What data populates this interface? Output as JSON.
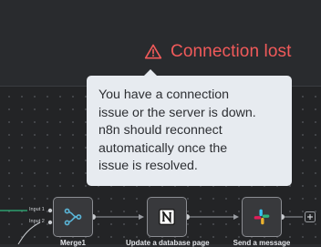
{
  "status": {
    "label": "Connection lost",
    "icon": "warning-triangle-icon",
    "color": "#f15a5a"
  },
  "tooltip": {
    "lines": [
      "You have a connection",
      "issue or the server is down.",
      "n8n should reconnect",
      "automatically once the",
      "issue is resolved."
    ]
  },
  "workflow": {
    "nodes": [
      {
        "label": "Merge1",
        "icon": "merge-icon",
        "inputs": [
          "Input 1",
          "Input 2"
        ]
      },
      {
        "label": "Update a database page",
        "icon": "notion-icon"
      },
      {
        "label": "Send a message",
        "icon": "slack-icon"
      }
    ],
    "add_icon": "plus-icon"
  },
  "colors": {
    "canvas": "#232426",
    "accent_green": "#2fb67c",
    "merge_icon": "#5ab4d6"
  }
}
